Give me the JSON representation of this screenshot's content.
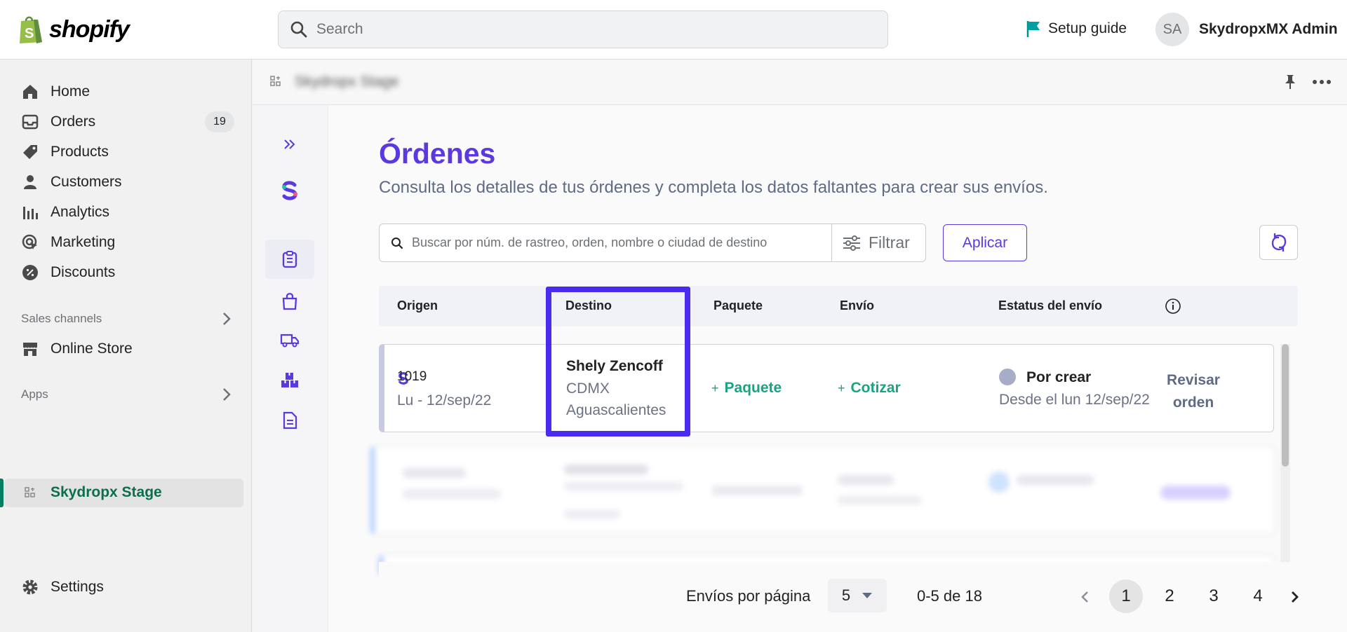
{
  "topbar": {
    "logo_text": "shopify",
    "search_placeholder": "Search",
    "setup_guide": "Setup guide",
    "avatar_initials": "SA",
    "account_name": "SkydropxMX Admin"
  },
  "sidebar": {
    "items": [
      {
        "label": "Home",
        "icon": "home-icon"
      },
      {
        "label": "Orders",
        "icon": "orders-icon",
        "badge": "19"
      },
      {
        "label": "Products",
        "icon": "tag-icon"
      },
      {
        "label": "Customers",
        "icon": "person-icon"
      },
      {
        "label": "Analytics",
        "icon": "bar-chart-icon"
      },
      {
        "label": "Marketing",
        "icon": "target-icon"
      },
      {
        "label": "Discounts",
        "icon": "discount-icon"
      }
    ],
    "sales_channels_label": "Sales channels",
    "online_store": "Online Store",
    "apps_label": "Apps",
    "active_app": "Skydropx Stage",
    "settings": "Settings"
  },
  "app_header": {
    "app_name_blurred": "Skydropx Stage"
  },
  "orders_page": {
    "title": "Órdenes",
    "subtitle": "Consulta los detalles de tus órdenes y completa los datos faltantes para crear sus envíos.",
    "search_placeholder": "Buscar por núm. de rastreo, orden, nombre o ciudad de destino",
    "filter_label": "Filtrar",
    "apply_label": "Aplicar",
    "columns": [
      "Origen",
      "Destino",
      "Paquete",
      "Envío",
      "Estatus del envío"
    ],
    "row": {
      "order_number": "1019",
      "date": "Lu - 12/sep/22",
      "customer_name": "Shely Zencoff",
      "city": "CDMX",
      "state": "Aguascalientes",
      "package_action": "Paquete",
      "quote_action": "Cotizar",
      "status": "Por crear",
      "status_since": "Desde el lun 12/sep/22",
      "review_line1": "Revisar",
      "review_line2": "orden"
    },
    "pagination": {
      "per_page_label": "Envíos por página",
      "per_page_value": "5",
      "range": "0-5 de 18",
      "pages": [
        "1",
        "2",
        "3",
        "4"
      ],
      "current_page": "1"
    }
  },
  "colors": {
    "accent": "#5b38e0",
    "highlight_border": "#4b2bf0",
    "green_action": "#1aa383",
    "shopify_green": "#008060"
  }
}
